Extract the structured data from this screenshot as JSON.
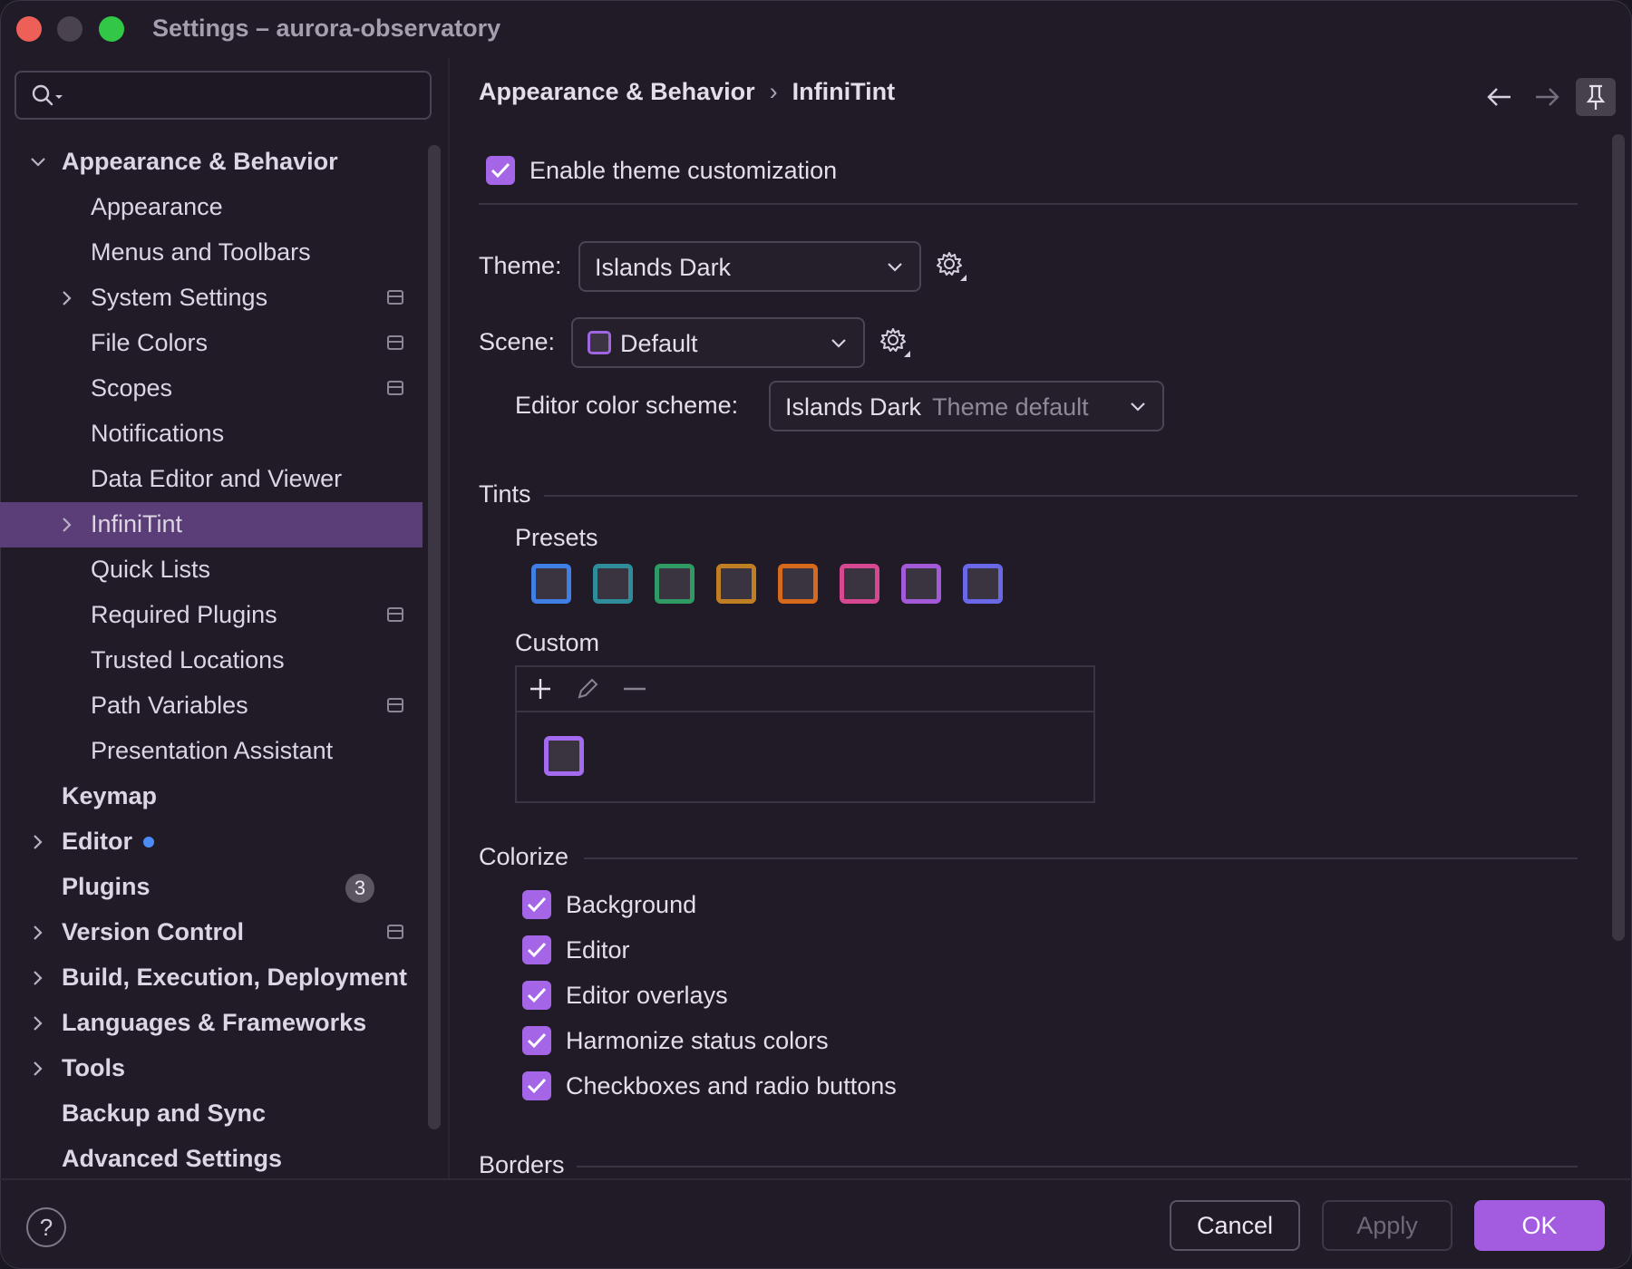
{
  "window": {
    "title": "Settings – aurora-observatory"
  },
  "search": {
    "placeholder": ""
  },
  "sidebar": {
    "items": [
      {
        "label": "Appearance & Behavior",
        "level": 0,
        "expanded": true
      },
      {
        "label": "Appearance",
        "level": 1
      },
      {
        "label": "Menus and Toolbars",
        "level": 1
      },
      {
        "label": "System Settings",
        "level": 1,
        "has_children": true,
        "project": true
      },
      {
        "label": "File Colors",
        "level": 1,
        "project": true
      },
      {
        "label": "Scopes",
        "level": 1,
        "project": true
      },
      {
        "label": "Notifications",
        "level": 1
      },
      {
        "label": "Data Editor and Viewer",
        "level": 1
      },
      {
        "label": "InfiniTint",
        "level": 1,
        "has_children": true,
        "selected": true
      },
      {
        "label": "Quick Lists",
        "level": 1
      },
      {
        "label": "Required Plugins",
        "level": 1,
        "project": true
      },
      {
        "label": "Trusted Locations",
        "level": 1
      },
      {
        "label": "Path Variables",
        "level": 1,
        "project": true
      },
      {
        "label": "Presentation Assistant",
        "level": 1
      },
      {
        "label": "Keymap",
        "level": 0
      },
      {
        "label": "Editor",
        "level": 0,
        "has_children": true,
        "modified_dot": true
      },
      {
        "label": "Plugins",
        "level": 0,
        "badge": "3"
      },
      {
        "label": "Version Control",
        "level": 0,
        "has_children": true,
        "project": true
      },
      {
        "label": "Build, Execution, Deployment",
        "level": 0,
        "has_children": true
      },
      {
        "label": "Languages & Frameworks",
        "level": 0,
        "has_children": true
      },
      {
        "label": "Tools",
        "level": 0,
        "has_children": true
      },
      {
        "label": "Backup and Sync",
        "level": 0
      },
      {
        "label": "Advanced Settings",
        "level": 0
      }
    ]
  },
  "breadcrumb": {
    "parent": "Appearance & Behavior",
    "separator": "›",
    "current": "InfiniTint"
  },
  "content": {
    "enable_label": "Enable theme customization",
    "enable_checked": true,
    "theme": {
      "label": "Theme:",
      "value": "Islands Dark"
    },
    "scene": {
      "label": "Scene:",
      "value": "Default"
    },
    "editor_scheme": {
      "label": "Editor color scheme:",
      "value": "Islands Dark",
      "hint": "Theme default"
    },
    "tints": {
      "title": "Tints",
      "presets_label": "Presets",
      "presets": [
        "#3f7fe6",
        "#2f8c9a",
        "#2f9a63",
        "#c07f22",
        "#d56a1d",
        "#d6488f",
        "#a35ad8",
        "#6a68e8"
      ],
      "custom_label": "Custom",
      "custom": [
        "#a46af0"
      ]
    },
    "colorize": {
      "title": "Colorize",
      "options": [
        {
          "label": "Background",
          "checked": true
        },
        {
          "label": "Editor",
          "checked": true
        },
        {
          "label": "Editor overlays",
          "checked": true
        },
        {
          "label": "Harmonize status colors",
          "checked": true
        },
        {
          "label": "Checkboxes and radio buttons",
          "checked": true
        }
      ]
    },
    "borders": {
      "title": "Borders"
    }
  },
  "footer": {
    "help": "?",
    "cancel": "Cancel",
    "apply": "Apply",
    "ok": "OK"
  },
  "colors": {
    "accent": "#a465e7",
    "selection": "#5b3e77",
    "background": "#211b27"
  }
}
